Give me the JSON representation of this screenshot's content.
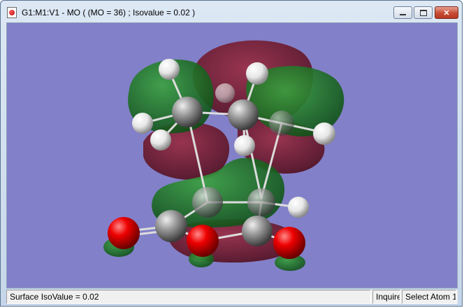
{
  "window": {
    "title": "G1:M1:V1 - MO ( (MO = 36) ; Isovalue = 0.02 )",
    "controls": {
      "minimize_icon": "minimize-icon",
      "maximize_icon": "maximize-icon",
      "close_glyph": "✕"
    }
  },
  "viewport": {
    "background_color": "#8280c8",
    "positive_lobe_color": "#1f7a2a",
    "negative_lobe_color": "#7a1a2e",
    "carbon_color": "#9a9a9a",
    "hydrogen_color": "#f2f2f2",
    "oxygen_color": "#e00000"
  },
  "statusbar": {
    "surface_text": "Surface IsoValue = 0.02",
    "mode_text": "Inquire",
    "select_text": "Select Atom 1"
  }
}
